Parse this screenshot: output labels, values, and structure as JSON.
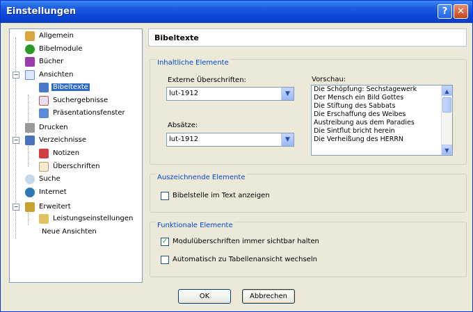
{
  "window": {
    "title": "Einstellungen",
    "help_glyph": "?",
    "close_glyph": "✕"
  },
  "tree": {
    "items": [
      {
        "label": "Allgemein",
        "icon": "pencil-icon",
        "color": "#d8a640"
      },
      {
        "label": "Bibelmodule",
        "icon": "globe-green-icon",
        "color": "#2a9a2a"
      },
      {
        "label": "Bücher",
        "icon": "books-icon",
        "color": "#9b3aa8"
      },
      {
        "label": "Ansichten",
        "icon": "page-icon",
        "color": "#6a8fd0"
      },
      {
        "label": "Bibeltexte",
        "icon": "bibletext-icon",
        "color": "#4a78c8"
      },
      {
        "label": "Suchergebnisse",
        "icon": "search-results-icon",
        "color": "#c05050"
      },
      {
        "label": "Präsentationsfenster",
        "icon": "presentation-icon",
        "color": "#5a8ad8"
      },
      {
        "label": "Drucken",
        "icon": "printer-icon",
        "color": "#8a8a8a"
      },
      {
        "label": "Verzeichnisse",
        "icon": "directory-icon",
        "color": "#4a70c0"
      },
      {
        "label": "Notizen",
        "icon": "notes-icon",
        "color": "#d04040"
      },
      {
        "label": "Überschriften",
        "icon": "headings-icon",
        "color": "#c0a060"
      },
      {
        "label": "Suche",
        "icon": "magnifier-icon",
        "color": "#7a9ac0"
      },
      {
        "label": "Internet",
        "icon": "internet-globe-icon",
        "color": "#2a78b8"
      },
      {
        "label": "Erweitert",
        "icon": "advanced-icon",
        "color": "#c8a030"
      },
      {
        "label": "Leistungseinstellungen",
        "icon": "performance-icon",
        "color": "#c8a030"
      },
      {
        "label": "Neue Ansichten",
        "icon": "",
        "color": ""
      }
    ],
    "expand_collapsed": "−"
  },
  "panel": {
    "title": "Bibeltexte",
    "content_group": {
      "legend": "Inhaltliche Elemente",
      "external_headings_label": "Externe Überschriften:",
      "external_headings_value": "lut-1912",
      "paragraphs_label": "Absätze:",
      "paragraphs_value": "lut-1912",
      "preview_label": "Vorschau:",
      "preview_lines": [
        "Die Schöpfung: Sechstagewerk",
        "Der Mensch ein Bild Gottes",
        "Die Stiftung des Sabbats",
        "Die Erschaffung des Weibes",
        "Austreibung aus dem Paradies",
        "Die Sintflut bricht herein",
        "Die Verheißung des HERRN"
      ]
    },
    "marking_group": {
      "legend": "Auszeichnende Elemente",
      "show_verse_label": "Bibelstelle im Text anzeigen",
      "show_verse_checked": false
    },
    "functional_group": {
      "legend": "Funktionale Elemente",
      "keep_headings_label": "Modulüberschriften immer sichtbar halten",
      "keep_headings_checked": true,
      "auto_table_label": "Automatisch zu Tabellenansicht wechseln",
      "auto_table_checked": false
    }
  },
  "buttons": {
    "ok": "OK",
    "cancel": "Abbrechen"
  },
  "glyphs": {
    "dropdown_arrow": "▼",
    "scroll_up": "▲",
    "scroll_down": "▼",
    "check": "✓"
  }
}
